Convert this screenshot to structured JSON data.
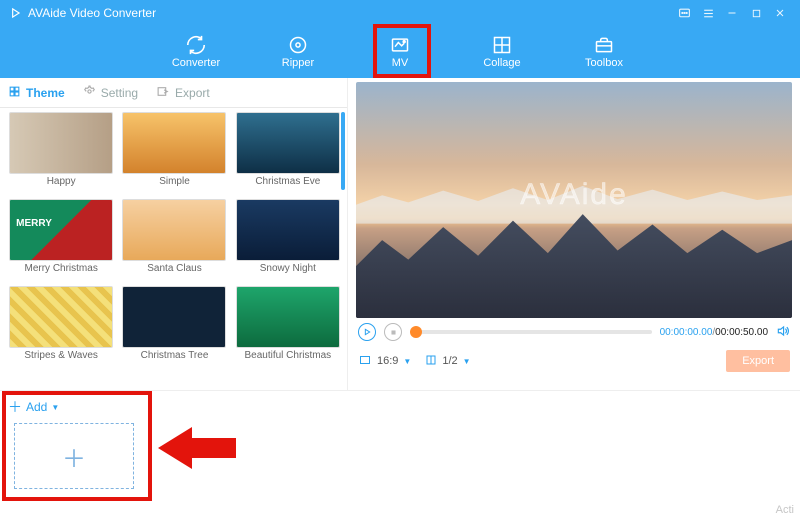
{
  "title": "AVAide Video Converter",
  "nav": {
    "items": [
      {
        "label": "Converter"
      },
      {
        "label": "Ripper"
      },
      {
        "label": "MV"
      },
      {
        "label": "Collage"
      },
      {
        "label": "Toolbox"
      }
    ],
    "active_index": 2
  },
  "tabs": {
    "theme": "Theme",
    "setting": "Setting",
    "export": "Export"
  },
  "themes": [
    {
      "label": "Happy",
      "cls": "t-happy"
    },
    {
      "label": "Simple",
      "cls": "t-simple"
    },
    {
      "label": "Christmas Eve",
      "cls": "t-ceve"
    },
    {
      "label": "Merry Christmas",
      "cls": "t-merry"
    },
    {
      "label": "Santa Claus",
      "cls": "t-santa"
    },
    {
      "label": "Snowy Night",
      "cls": "t-snowy"
    },
    {
      "label": "Stripes & Waves",
      "cls": "t-stripes"
    },
    {
      "label": "Christmas Tree",
      "cls": "t-ctree"
    },
    {
      "label": "Beautiful Christmas",
      "cls": "t-bchrist"
    }
  ],
  "preview": {
    "brand": "AVAide"
  },
  "player": {
    "elapsed": "00:00:00.00",
    "duration": "00:00:50.00"
  },
  "options": {
    "aspect": "16:9",
    "page": "1/2",
    "export_label": "Export"
  },
  "add": {
    "label": "Add"
  },
  "activate": "Acti"
}
